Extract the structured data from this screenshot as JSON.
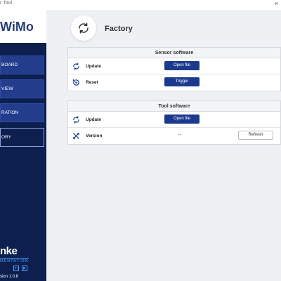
{
  "window": {
    "title": "r Tool",
    "close_glyph": "×"
  },
  "sidebar": {
    "logo": "WiMo",
    "items": [
      {
        "label": "BOARD",
        "icon": "dashboard",
        "active": false
      },
      {
        "label": "VIEW",
        "icon": "overview",
        "active": false
      },
      {
        "label": "RATION",
        "icon": "configuration",
        "active": false
      },
      {
        "label": "ORY",
        "icon": "factory",
        "active": true
      }
    ],
    "brand": "nke",
    "brand_sub": "MENTATION",
    "social_icons": [
      "linkedin-icon",
      "youtube-icon"
    ],
    "version": "sion 1.0.8"
  },
  "header": {
    "title": "Factory",
    "icon": "refresh-icon"
  },
  "sensor_panel": {
    "title": "Sensor software",
    "rows": [
      {
        "label": "Update",
        "icon": "sync-icon",
        "button": "Open file"
      },
      {
        "label": "Reset",
        "icon": "reset-icon",
        "button": "Trigger"
      }
    ]
  },
  "tool_panel": {
    "title": "Tool software",
    "rows": [
      {
        "label": "Update",
        "icon": "sync-icon",
        "button": "Open file"
      },
      {
        "label": "Version",
        "icon": "tools-icon",
        "value": "--",
        "button": "Refresh"
      }
    ]
  },
  "colors": {
    "sidebar_bg": "#0c1f4f",
    "nav_item_bg": "#233d8c",
    "primary_button": "#1b3a8e",
    "content_bg": "#eef0f4"
  }
}
